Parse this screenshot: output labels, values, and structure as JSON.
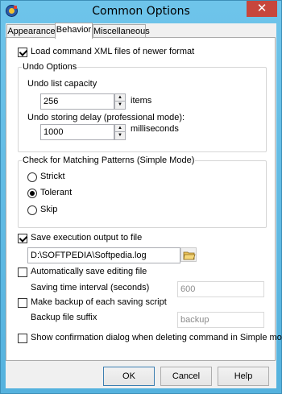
{
  "window": {
    "title": "Common Options"
  },
  "tabs": [
    {
      "label": "Appearance"
    },
    {
      "label": "Behavior"
    },
    {
      "label": "Miscellaneous"
    }
  ],
  "behavior": {
    "load_xml_label": "Load command XML files of newer format",
    "undo_group_label": "Undo Options",
    "undo_capacity_label": "Undo list capacity",
    "undo_capacity_value": "256",
    "undo_capacity_unit": "items",
    "undo_delay_label": "Undo storing delay (professional mode):",
    "undo_delay_value": "1000",
    "undo_delay_unit": "milliseconds",
    "pattern_group_label": "Check for Matching Patterns (Simple Mode)",
    "pattern_options": [
      "Strickt",
      "Tolerant",
      "Skip"
    ],
    "pattern_selected": "Tolerant",
    "save_exec_label": "Save execution output to file",
    "save_exec_path": "D:\\SOFTPEDIA\\Softpedia.log",
    "auto_save_label": "Automatically save editing file",
    "saving_interval_label": "Saving time interval (seconds)",
    "saving_interval_value": "600",
    "backup_label": "Make backup of each saving script",
    "backup_suffix_label": "Backup file suffix",
    "backup_suffix_value": "backup",
    "confirm_label": "Show confirmation dialog when deleting command in Simple mode"
  },
  "checks": {
    "load_xml": true,
    "save_exec": true,
    "auto_save": false,
    "backup": false,
    "confirm": false
  },
  "buttons": {
    "ok": "OK",
    "cancel": "Cancel",
    "help": "Help"
  },
  "icons": {
    "app": "app-icon",
    "folder": "folder-open-icon",
    "close": "close-icon"
  }
}
